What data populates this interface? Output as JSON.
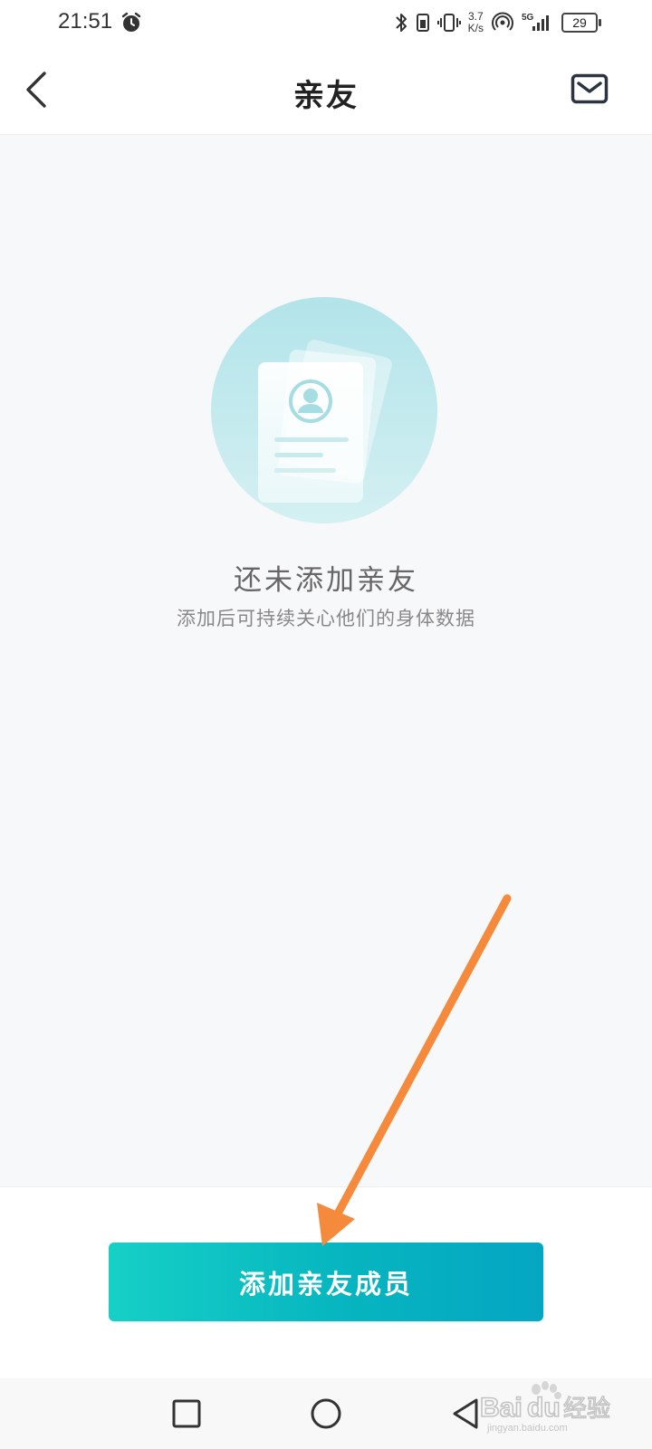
{
  "status_bar": {
    "time": "21:51",
    "speed_value": "3.7",
    "speed_unit": "K/s",
    "battery": "29",
    "icons": [
      "alarm-icon",
      "bluetooth-icon",
      "battery-saver-icon",
      "vibrate-icon",
      "hotspot-icon",
      "5g-signal-icon",
      "battery-icon"
    ]
  },
  "header": {
    "title": "亲友",
    "back_icon": "chevron-left-icon",
    "message_icon": "mail-icon"
  },
  "empty_state": {
    "illustration_icon": "contact-card-icon",
    "title": "还未添加亲友",
    "subtitle": "添加后可持续关心他们的身体数据"
  },
  "actions": {
    "add_member_label": "添加亲友成员"
  },
  "nav_bar": {
    "items": [
      "recent-apps-icon",
      "home-icon",
      "back-icon"
    ]
  },
  "watermark": {
    "text_left": "Bai",
    "text_right": "du",
    "text_cn": "经验",
    "url": "jingyan.baidu.com"
  },
  "colors": {
    "accent_start": "#16d0c6",
    "accent_end": "#05a6c2",
    "annotation_arrow": "#f58a3c",
    "background": "#f7f8fa"
  }
}
